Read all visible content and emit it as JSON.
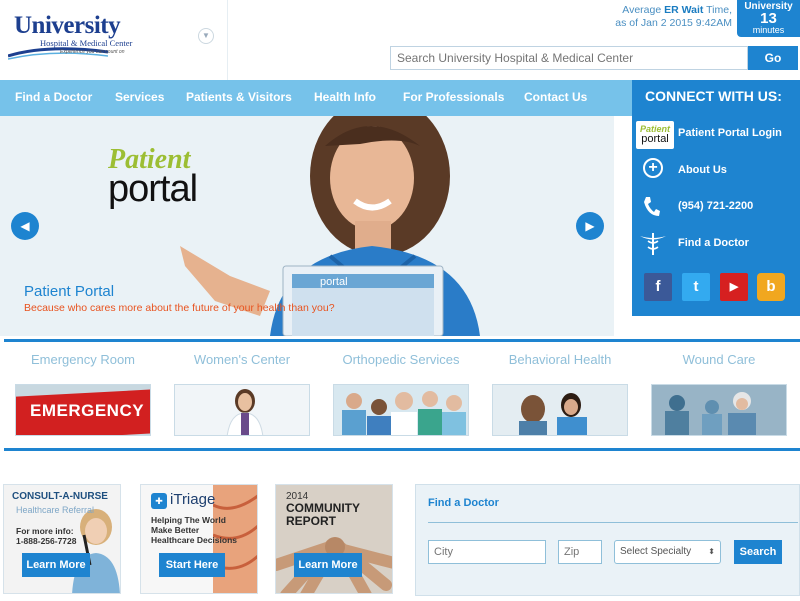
{
  "header": {
    "logo_main": "University",
    "logo_sub": "Hospital & Medical Center",
    "logo_tag": "Experience you can count on",
    "er_prefix": "Average",
    "er_strong": "ER Wait",
    "er_suffix": "Time,",
    "er_date": "as of Jan 2 2015 9:42AM",
    "er_box_title": "University",
    "er_box_value": "13",
    "er_box_unit": "minutes",
    "search_placeholder": "Search University Hospital & Medical Center",
    "search_button": "Go"
  },
  "nav": {
    "items": [
      "Find a Doctor",
      "Services",
      "Patients & Visitors",
      "Health Info",
      "For Professionals",
      "Contact Us"
    ]
  },
  "connect": {
    "title": "CONNECT WITH US:",
    "items": [
      {
        "label": "Patient Portal Login",
        "icon": "patient-portal-icon"
      },
      {
        "label": "About Us",
        "icon": "plus-circle-icon"
      },
      {
        "label": "(954) 721-2200",
        "icon": "phone-icon"
      },
      {
        "label": "Find a Doctor",
        "icon": "caduceus-icon"
      }
    ],
    "social": [
      {
        "name": "facebook-icon",
        "glyph": "f",
        "color": "#3b5998"
      },
      {
        "name": "twitter-icon",
        "glyph": "t",
        "color": "#33aaf0"
      },
      {
        "name": "youtube-icon",
        "glyph": "▶",
        "color": "#d62020"
      },
      {
        "name": "blog-icon",
        "glyph": "b",
        "color": "#f1a71f"
      }
    ]
  },
  "hero": {
    "logo_word1": "Patient",
    "logo_word2": "portal",
    "title": "Patient Portal",
    "subtitle": "Because who cares more about the future of your health than you?",
    "laptop_text": "portal"
  },
  "services": [
    {
      "label": "Emergency Room",
      "image_text": "EMERGENCY"
    },
    {
      "label": "Women's Center",
      "image_text": ""
    },
    {
      "label": "Orthopedic Services",
      "image_text": ""
    },
    {
      "label": "Behavioral Health",
      "image_text": ""
    },
    {
      "label": "Wound Care",
      "image_text": ""
    }
  ],
  "promos": [
    {
      "title": "CONSULT-A-NURSE",
      "subtitle": "Healthcare Referral",
      "info_label": "For more info:",
      "phone": "1-888-256-7728",
      "button": "Learn More"
    },
    {
      "title": "iTriage",
      "subtitle": "Helping The World Make Better Healthcare Decisions",
      "button": "Start Here"
    },
    {
      "title_year": "2014",
      "title": "COMMUNITY REPORT",
      "button": "Learn More"
    }
  ],
  "find_doctor": {
    "title": "Find a Doctor",
    "city_placeholder": "City",
    "zip_placeholder": "Zip",
    "specialty": "Select Specialty",
    "button": "Search"
  }
}
